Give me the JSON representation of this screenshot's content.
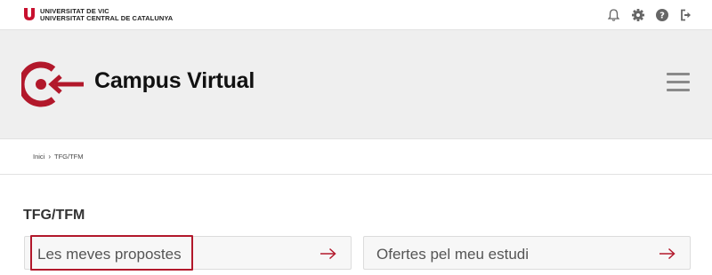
{
  "topbar": {
    "university_line1": "UNIVERSITAT DE VIC",
    "university_line2": "UNIVERSITAT CENTRAL DE CATALUNYA",
    "icons": [
      "bell-icon",
      "gear-icon",
      "help-icon",
      "logout-icon"
    ],
    "brand_color": "#c8102e",
    "icon_color": "#666666"
  },
  "header": {
    "title": "Campus Virtual",
    "background": "#efefef",
    "menu_icon": "hamburger-icon"
  },
  "breadcrumb": {
    "home": "Inici",
    "separator": "›",
    "current": "TFG/TFM"
  },
  "main": {
    "title": "TFG/TFM",
    "cards": [
      {
        "label": "Les meves propostes",
        "icon": "arrow-right-icon",
        "highlighted": true
      },
      {
        "label": "Ofertes pel meu estudi",
        "icon": "arrow-right-icon",
        "highlighted": false
      }
    ],
    "accent_color": "#b2182b"
  }
}
